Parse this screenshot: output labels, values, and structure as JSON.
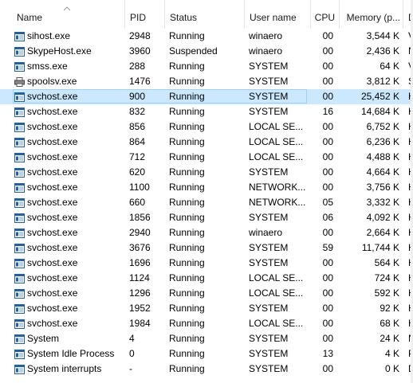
{
  "columns": {
    "name": "Name",
    "pid": "PID",
    "status": "Status",
    "user": "User name",
    "cpu": "CPU",
    "memory": "Memory (p...",
    "desc": "D"
  },
  "rows": [
    {
      "name": "sihost.exe",
      "pid": "2948",
      "status": "Running",
      "user": "winaero",
      "cpu": "00",
      "memory": "3,544 K",
      "desc": "V",
      "icon": "window-icon"
    },
    {
      "name": "SkypeHost.exe",
      "pid": "3960",
      "status": "Suspended",
      "user": "winaero",
      "cpu": "00",
      "memory": "2,436 K",
      "desc": "N",
      "icon": "window-icon"
    },
    {
      "name": "smss.exe",
      "pid": "288",
      "status": "Running",
      "user": "SYSTEM",
      "cpu": "00",
      "memory": "64 K",
      "desc": "V",
      "icon": "window-icon"
    },
    {
      "name": "spoolsv.exe",
      "pid": "1476",
      "status": "Running",
      "user": "SYSTEM",
      "cpu": "00",
      "memory": "3,812 K",
      "desc": "S",
      "icon": "printer-icon"
    },
    {
      "name": "svchost.exe",
      "pid": "900",
      "status": "Running",
      "user": "SYSTEM",
      "cpu": "00",
      "memory": "25,452 K",
      "desc": "H",
      "icon": "window-icon",
      "selected": true
    },
    {
      "name": "svchost.exe",
      "pid": "832",
      "status": "Running",
      "user": "SYSTEM",
      "cpu": "16",
      "memory": "14,684 K",
      "desc": "H",
      "icon": "window-icon"
    },
    {
      "name": "svchost.exe",
      "pid": "856",
      "status": "Running",
      "user": "LOCAL SE...",
      "cpu": "00",
      "memory": "6,752 K",
      "desc": "H",
      "icon": "window-icon"
    },
    {
      "name": "svchost.exe",
      "pid": "864",
      "status": "Running",
      "user": "LOCAL SE...",
      "cpu": "00",
      "memory": "6,236 K",
      "desc": "H",
      "icon": "window-icon"
    },
    {
      "name": "svchost.exe",
      "pid": "712",
      "status": "Running",
      "user": "LOCAL SE...",
      "cpu": "00",
      "memory": "4,488 K",
      "desc": "H",
      "icon": "window-icon"
    },
    {
      "name": "svchost.exe",
      "pid": "620",
      "status": "Running",
      "user": "SYSTEM",
      "cpu": "00",
      "memory": "4,664 K",
      "desc": "H",
      "icon": "window-icon"
    },
    {
      "name": "svchost.exe",
      "pid": "1100",
      "status": "Running",
      "user": "NETWORK...",
      "cpu": "00",
      "memory": "3,756 K",
      "desc": "H",
      "icon": "window-icon"
    },
    {
      "name": "svchost.exe",
      "pid": "660",
      "status": "Running",
      "user": "NETWORK...",
      "cpu": "05",
      "memory": "3,332 K",
      "desc": "H",
      "icon": "window-icon"
    },
    {
      "name": "svchost.exe",
      "pid": "1856",
      "status": "Running",
      "user": "SYSTEM",
      "cpu": "06",
      "memory": "4,092 K",
      "desc": "H",
      "icon": "window-icon"
    },
    {
      "name": "svchost.exe",
      "pid": "2940",
      "status": "Running",
      "user": "winaero",
      "cpu": "00",
      "memory": "2,664 K",
      "desc": "H",
      "icon": "window-icon"
    },
    {
      "name": "svchost.exe",
      "pid": "3676",
      "status": "Running",
      "user": "SYSTEM",
      "cpu": "59",
      "memory": "11,744 K",
      "desc": "H",
      "icon": "window-icon"
    },
    {
      "name": "svchost.exe",
      "pid": "1696",
      "status": "Running",
      "user": "SYSTEM",
      "cpu": "00",
      "memory": "564 K",
      "desc": "H",
      "icon": "window-icon"
    },
    {
      "name": "svchost.exe",
      "pid": "1124",
      "status": "Running",
      "user": "LOCAL SE...",
      "cpu": "00",
      "memory": "724 K",
      "desc": "H",
      "icon": "window-icon"
    },
    {
      "name": "svchost.exe",
      "pid": "1296",
      "status": "Running",
      "user": "LOCAL SE...",
      "cpu": "00",
      "memory": "592 K",
      "desc": "H",
      "icon": "window-icon"
    },
    {
      "name": "svchost.exe",
      "pid": "1952",
      "status": "Running",
      "user": "SYSTEM",
      "cpu": "00",
      "memory": "92 K",
      "desc": "H",
      "icon": "window-icon"
    },
    {
      "name": "svchost.exe",
      "pid": "1984",
      "status": "Running",
      "user": "LOCAL SE...",
      "cpu": "00",
      "memory": "68 K",
      "desc": "H",
      "icon": "window-icon"
    },
    {
      "name": "System",
      "pid": "4",
      "status": "Running",
      "user": "SYSTEM",
      "cpu": "00",
      "memory": "24 K",
      "desc": "N",
      "icon": "window-icon"
    },
    {
      "name": "System Idle Process",
      "pid": "0",
      "status": "Running",
      "user": "SYSTEM",
      "cpu": "13",
      "memory": "4 K",
      "desc": "P",
      "icon": "window-icon"
    },
    {
      "name": "System interrupts",
      "pid": "-",
      "status": "Running",
      "user": "SYSTEM",
      "cpu": "00",
      "memory": "0 K",
      "desc": "D",
      "icon": "window-icon"
    }
  ],
  "colors": {
    "selected_bg": "#cce8ff",
    "selected_border": "#99d1ff",
    "icon_blue": "#1e5fb4"
  }
}
